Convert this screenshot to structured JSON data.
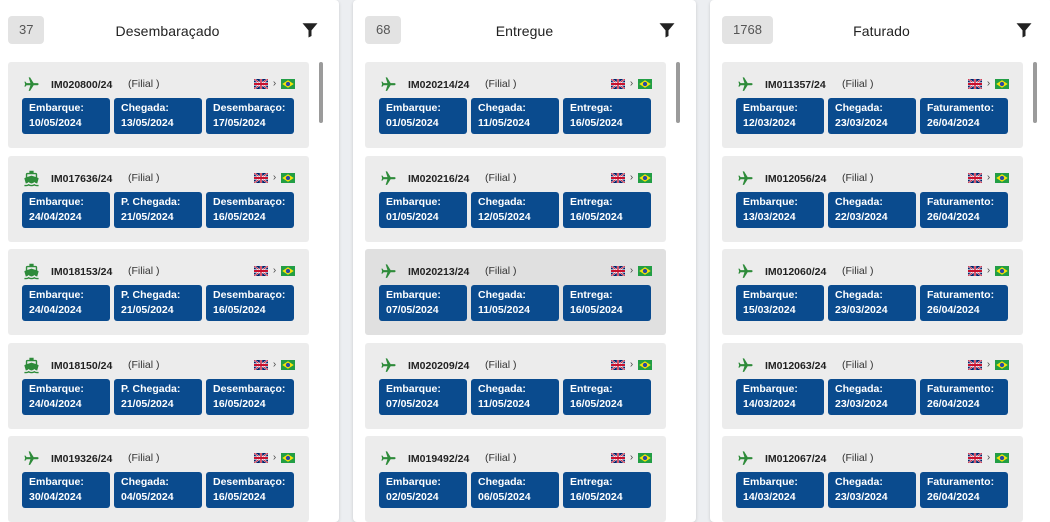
{
  "columns": [
    {
      "count": "37",
      "title": "Desembaraçado",
      "cards": [
        {
          "code": "IM020800/24",
          "branch": "(Filial )",
          "mode": "plane",
          "dates": [
            [
              "Embarque:",
              "10/05/2024"
            ],
            [
              "Chegada:",
              "13/05/2024"
            ],
            [
              "Desembaraço:",
              "17/05/2024"
            ]
          ]
        },
        {
          "code": "IM017636/24",
          "branch": "(Filial )",
          "mode": "ship",
          "dates": [
            [
              "Embarque:",
              "24/04/2024"
            ],
            [
              "P. Chegada:",
              "21/05/2024"
            ],
            [
              "Desembaraço:",
              "16/05/2024"
            ]
          ]
        },
        {
          "code": "IM018153/24",
          "branch": "(Filial )",
          "mode": "ship",
          "dates": [
            [
              "Embarque:",
              "24/04/2024"
            ],
            [
              "P. Chegada:",
              "21/05/2024"
            ],
            [
              "Desembaraço:",
              "16/05/2024"
            ]
          ]
        },
        {
          "code": "IM018150/24",
          "branch": "(Filial )",
          "mode": "ship",
          "dates": [
            [
              "Embarque:",
              "24/04/2024"
            ],
            [
              "P. Chegada:",
              "21/05/2024"
            ],
            [
              "Desembaraço:",
              "16/05/2024"
            ]
          ]
        },
        {
          "code": "IM019326/24",
          "branch": "(Filial )",
          "mode": "plane",
          "dates": [
            [
              "Embarque:",
              "30/04/2024"
            ],
            [
              "Chegada:",
              "04/05/2024"
            ],
            [
              "Desembaraço:",
              "16/05/2024"
            ]
          ]
        }
      ]
    },
    {
      "count": "68",
      "title": "Entregue",
      "cards": [
        {
          "code": "IM020214/24",
          "branch": "(Filial )",
          "mode": "plane",
          "dates": [
            [
              "Embarque:",
              "01/05/2024"
            ],
            [
              "Chegada:",
              "11/05/2024"
            ],
            [
              "Entrega:",
              "16/05/2024"
            ]
          ]
        },
        {
          "code": "IM020216/24",
          "branch": "(Filial )",
          "mode": "plane",
          "dates": [
            [
              "Embarque:",
              "01/05/2024"
            ],
            [
              "Chegada:",
              "12/05/2024"
            ],
            [
              "Entrega:",
              "16/05/2024"
            ]
          ]
        },
        {
          "code": "IM020213/24",
          "branch": "(Filial )",
          "mode": "plane",
          "highlight": true,
          "dates": [
            [
              "Embarque:",
              "07/05/2024"
            ],
            [
              "Chegada:",
              "11/05/2024"
            ],
            [
              "Entrega:",
              "16/05/2024"
            ]
          ]
        },
        {
          "code": "IM020209/24",
          "branch": "(Filial )",
          "mode": "plane",
          "dates": [
            [
              "Embarque:",
              "07/05/2024"
            ],
            [
              "Chegada:",
              "11/05/2024"
            ],
            [
              "Entrega:",
              "16/05/2024"
            ]
          ]
        },
        {
          "code": "IM019492/24",
          "branch": "(Filial )",
          "mode": "plane",
          "dates": [
            [
              "Embarque:",
              "02/05/2024"
            ],
            [
              "Chegada:",
              "06/05/2024"
            ],
            [
              "Entrega:",
              "16/05/2024"
            ]
          ]
        }
      ]
    },
    {
      "count": "1768",
      "title": "Faturado",
      "cards": [
        {
          "code": "IM011357/24",
          "branch": "(Filial )",
          "mode": "plane",
          "dates": [
            [
              "Embarque:",
              "12/03/2024"
            ],
            [
              "Chegada:",
              "23/03/2024"
            ],
            [
              "Faturamento:",
              "26/04/2024"
            ]
          ]
        },
        {
          "code": "IM012056/24",
          "branch": "(Filial )",
          "mode": "plane",
          "dates": [
            [
              "Embarque:",
              "13/03/2024"
            ],
            [
              "Chegada:",
              "22/03/2024"
            ],
            [
              "Faturamento:",
              "26/04/2024"
            ]
          ]
        },
        {
          "code": "IM012060/24",
          "branch": "(Filial )",
          "mode": "plane",
          "dates": [
            [
              "Embarque:",
              "15/03/2024"
            ],
            [
              "Chegada:",
              "23/03/2024"
            ],
            [
              "Faturamento:",
              "26/04/2024"
            ]
          ]
        },
        {
          "code": "IM012063/24",
          "branch": "(Filial )",
          "mode": "plane",
          "dates": [
            [
              "Embarque:",
              "14/03/2024"
            ],
            [
              "Chegada:",
              "23/03/2024"
            ],
            [
              "Faturamento:",
              "26/04/2024"
            ]
          ]
        },
        {
          "code": "IM012067/24",
          "branch": "(Filial )",
          "mode": "plane",
          "dates": [
            [
              "Embarque:",
              "14/03/2024"
            ],
            [
              "Chegada:",
              "23/03/2024"
            ],
            [
              "Faturamento:",
              "26/04/2024"
            ]
          ]
        }
      ]
    }
  ],
  "flags": {
    "origin": "uk-flag-icon",
    "arrow": "›",
    "destination": "brazil-flag-icon"
  },
  "colors": {
    "date_box": "#0a4b8e",
    "mode_icon": "#2e8b3a",
    "card_bg": "#ececec"
  }
}
